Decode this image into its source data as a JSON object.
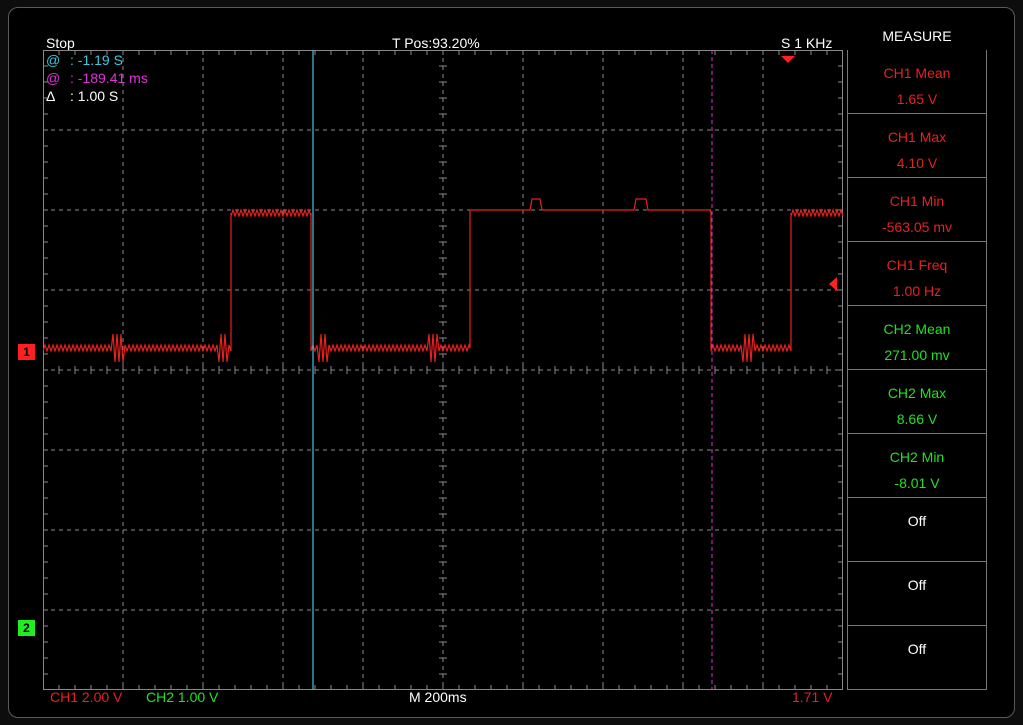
{
  "header": {
    "status": "Stop",
    "trigger_position": "T Pos:93.20%",
    "sample_rate": "S 1 KHz"
  },
  "cursors": [
    {
      "symbol": "@",
      "value": ": -1.19 S",
      "color": "#3ec8e0"
    },
    {
      "symbol": "@",
      "value": ": -189.41 ms",
      "color": "#e033d8"
    },
    {
      "symbol": "Δ",
      "value": ": 1.00 S",
      "color": "#ffffff"
    }
  ],
  "measure": {
    "title": "MEASURE",
    "items": [
      {
        "label": "CH1 Mean",
        "value": "1.65 V",
        "color": "#e82020"
      },
      {
        "label": "CH1 Max",
        "value": "4.10 V",
        "color": "#e82020"
      },
      {
        "label": "CH1 Min",
        "value": "-563.05 mv",
        "color": "#e82020"
      },
      {
        "label": "CH1 Freq",
        "value": "1.00 Hz",
        "color": "#e82020"
      },
      {
        "label": "CH2 Mean",
        "value": "271.00 mv",
        "color": "#22e022"
      },
      {
        "label": "CH2 Max",
        "value": "8.66 V",
        "color": "#22e022"
      },
      {
        "label": "CH2 Min",
        "value": "-8.01 V",
        "color": "#22e022"
      },
      {
        "label": "Off",
        "value": "",
        "color": "#ffffff"
      },
      {
        "label": "Off",
        "value": "",
        "color": "#ffffff"
      },
      {
        "label": "Off",
        "value": "",
        "color": "#ffffff"
      }
    ]
  },
  "footer": {
    "ch1_scale": "CH1 2.00 V",
    "ch2_scale": "CH2 1.00 V",
    "timebase": "M 200ms",
    "trigger_level": "1.71 V"
  },
  "markers": {
    "ch1": "1",
    "ch2": "2"
  },
  "colors": {
    "ch1": "#e82020",
    "ch2": "#22e022",
    "cursor_a": "#3ec8e0",
    "cursor_b": "#e033d8",
    "grid": "#8a8a8a"
  }
}
